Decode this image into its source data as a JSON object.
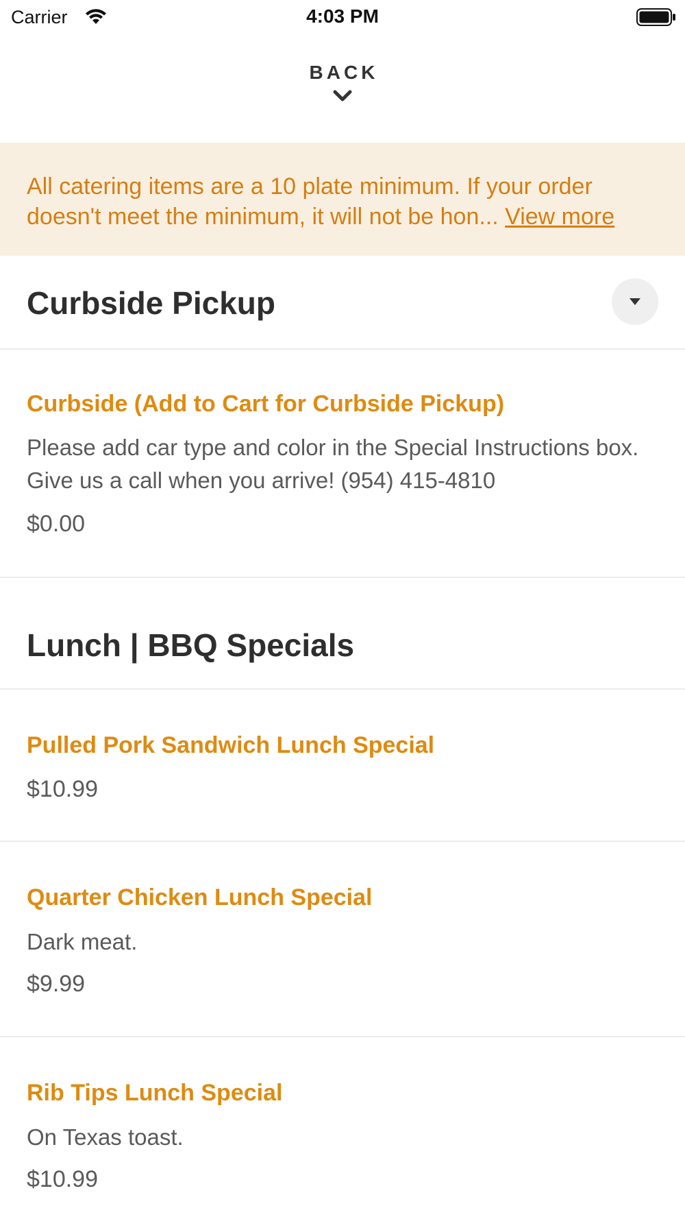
{
  "status_bar": {
    "carrier": "Carrier",
    "time": "4:03 PM"
  },
  "nav": {
    "back_label": "BACK"
  },
  "notice": {
    "text": "All catering items are a 10 plate minimum. If your order doesn't meet the minimum, it will not be hon...",
    "link": "View more"
  },
  "sections": [
    {
      "title": "Curbside Pickup",
      "items": [
        {
          "name": "Curbside (Add to Cart for Curbside Pickup)",
          "description": "Please add car type and color in the Special Instructions box. Give us a call when you arrive! (954) 415-4810",
          "price": "$0.00"
        }
      ]
    },
    {
      "title": "Lunch | BBQ Specials",
      "items": [
        {
          "name": "Pulled Pork Sandwich Lunch Special",
          "price": "$10.99"
        },
        {
          "name": "Quarter Chicken Lunch Special",
          "description": "Dark meat.",
          "price": "$9.99"
        },
        {
          "name": "Rib Tips Lunch Special",
          "description": "On Texas toast.",
          "price": "$10.99"
        }
      ]
    }
  ],
  "colors": {
    "accent": "#de8b11",
    "notice_background": "#f9efe0",
    "notice_text": "#d57e12"
  }
}
